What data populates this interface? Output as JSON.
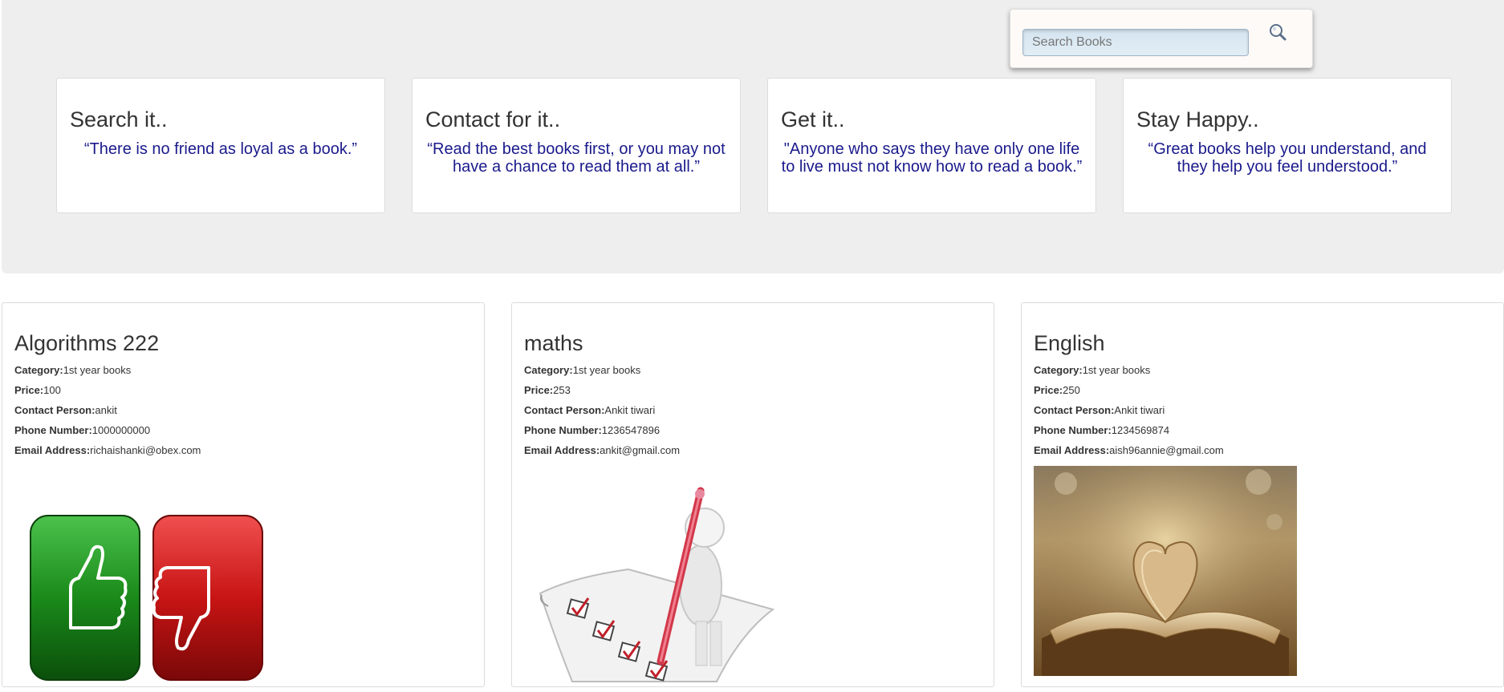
{
  "search": {
    "placeholder": "Search Books",
    "icon": "search-icon"
  },
  "quotes": [
    {
      "title": "Search it..",
      "text": "“There is no friend as loyal as a book.”"
    },
    {
      "title": "Contact for it..",
      "text": "“Read the best books first, or you may not have a chance to read them at all.”"
    },
    {
      "title": "Get it..",
      "text": "\"Anyone who says they have only one life to live must not know how to read a book.”"
    },
    {
      "title": "Stay Happy..",
      "text": "“Great books help you understand, and they help you feel understood.”"
    }
  ],
  "labels": {
    "category": "Category:",
    "price": "Price:",
    "contact": "Contact Person:",
    "phone": "Phone Number:",
    "email": "Email Address:"
  },
  "books": [
    {
      "title": "Algorithms 222",
      "category": "1st year books",
      "price": "100",
      "contact": "ankit",
      "phone": "1000000000",
      "email": "richaishanki@obex.com",
      "image": "thumbs-up-down-image"
    },
    {
      "title": "maths",
      "category": "1st year books",
      "price": "253",
      "contact": "Ankit tiwari",
      "phone": "1236547896",
      "email": "ankit@gmail.com",
      "image": "checklist-figure-image"
    },
    {
      "title": "English",
      "category": "1st year books",
      "price": "250",
      "contact": "Ankit tiwari",
      "phone": "1234569874",
      "email": "aish96annie@gmail.com",
      "image": "open-book-heart-image"
    }
  ],
  "colors": {
    "quote_text": "#1a1a8c",
    "hero_bg": "#eeeeee",
    "thumb_up": "#1a8a1a",
    "thumb_down": "#c81414"
  }
}
